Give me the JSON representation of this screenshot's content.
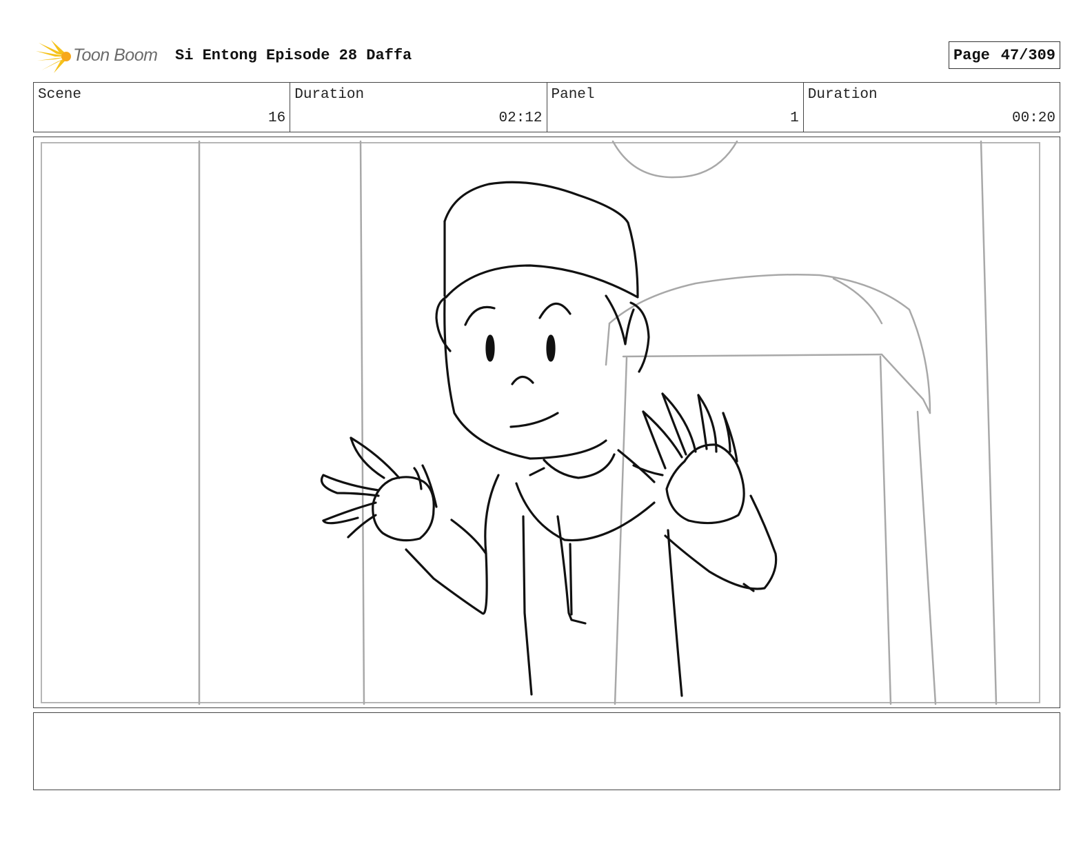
{
  "brand": {
    "name": "Toon Boom",
    "accent": "#f5c21b",
    "text_color": "#6b6b6b"
  },
  "header": {
    "project_title": "Si Entong Episode 28 Daffa",
    "page_label": "Page",
    "page_value": "47/309"
  },
  "info": {
    "scene_label": "Scene",
    "scene_value": "16",
    "scene_duration_label": "Duration",
    "scene_duration_value": "02:12",
    "panel_label": "Panel",
    "panel_value": "1",
    "panel_duration_label": "Duration",
    "panel_duration_value": "00:20"
  },
  "notes": {
    "text": ""
  },
  "colors": {
    "ink": "#111111",
    "guide": "#a8a8a8",
    "border": "#444444"
  }
}
